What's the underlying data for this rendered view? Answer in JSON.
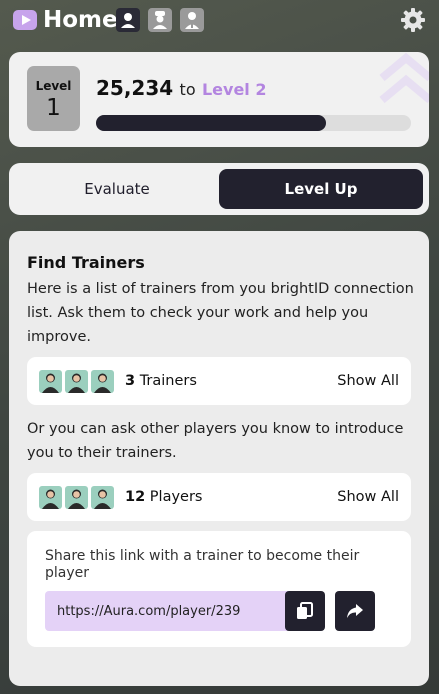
{
  "header": {
    "title": "Home",
    "icons": [
      "play-icon",
      "user-icon",
      "chef-icon",
      "doctor-icon",
      "gear-icon"
    ]
  },
  "level": {
    "label": "Level",
    "number": "1",
    "score": "25,234",
    "to_word": "to",
    "next_level": "Level 2",
    "progress_fraction": 0.73
  },
  "tabs": [
    {
      "label": "Evaluate",
      "active": false
    },
    {
      "label": "Level Up",
      "active": true
    }
  ],
  "find_trainers": {
    "title": "Find Trainers",
    "description": "Here is a list of trainers from you brightID connection list. Ask them to check your work and help you improve.",
    "trainers_count": "3",
    "trainers_label": "Trainers",
    "trainers_show_all": "Show All",
    "other_text": "Or you can ask other players you know to introduce you to their trainers.",
    "players_count": "12",
    "players_label": "Players",
    "players_show_all": "Show All"
  },
  "share": {
    "text": "Share this link with a trainer to become their player",
    "link": "https://Aura.com/player/239"
  },
  "colors": {
    "accent": "#b385e0",
    "dark": "#22212e",
    "link_bg": "#e4d2f7",
    "avatar_bg": "#9bcfbe"
  }
}
